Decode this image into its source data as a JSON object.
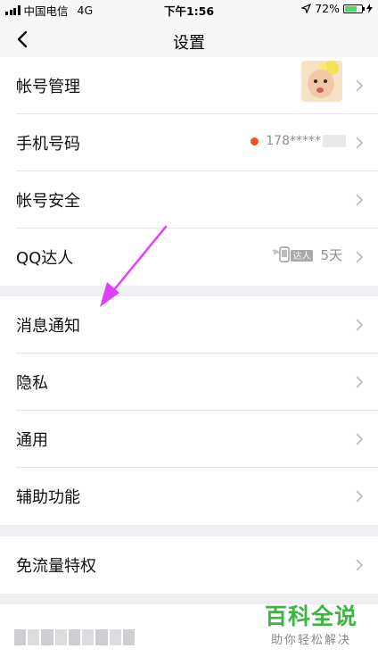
{
  "status_bar": {
    "carrier": "中国电信",
    "network": "4G",
    "time": "下午1:56",
    "battery": "72%"
  },
  "nav": {
    "title": "设置"
  },
  "groups": {
    "account": {
      "rows": [
        {
          "label": "帐号管理"
        },
        {
          "label": "手机号码",
          "value": "178*****"
        },
        {
          "label": "帐号安全"
        },
        {
          "label": "QQ达人",
          "badge": "达人",
          "value": "5天"
        }
      ]
    },
    "general": {
      "rows": [
        {
          "label": "消息通知"
        },
        {
          "label": "隐私"
        },
        {
          "label": "通用"
        },
        {
          "label": "辅助功能"
        }
      ]
    },
    "traffic": {
      "rows": [
        {
          "label": "免流量特权"
        }
      ]
    }
  },
  "watermark": {
    "title": "百科全说",
    "subtitle": "助你轻松解决"
  },
  "colors": {
    "background": "#efeff4",
    "accent_red": "#f4511e",
    "arrow_magenta": "#e040fb",
    "watermark_green": "#3db541",
    "battery_green": "#4cd964"
  },
  "icons": [
    "back-chevron-icon",
    "chevron-right-icon",
    "location-arrow-icon",
    "battery-icon",
    "charging-bolt-icon",
    "daren-badge-icon"
  ]
}
